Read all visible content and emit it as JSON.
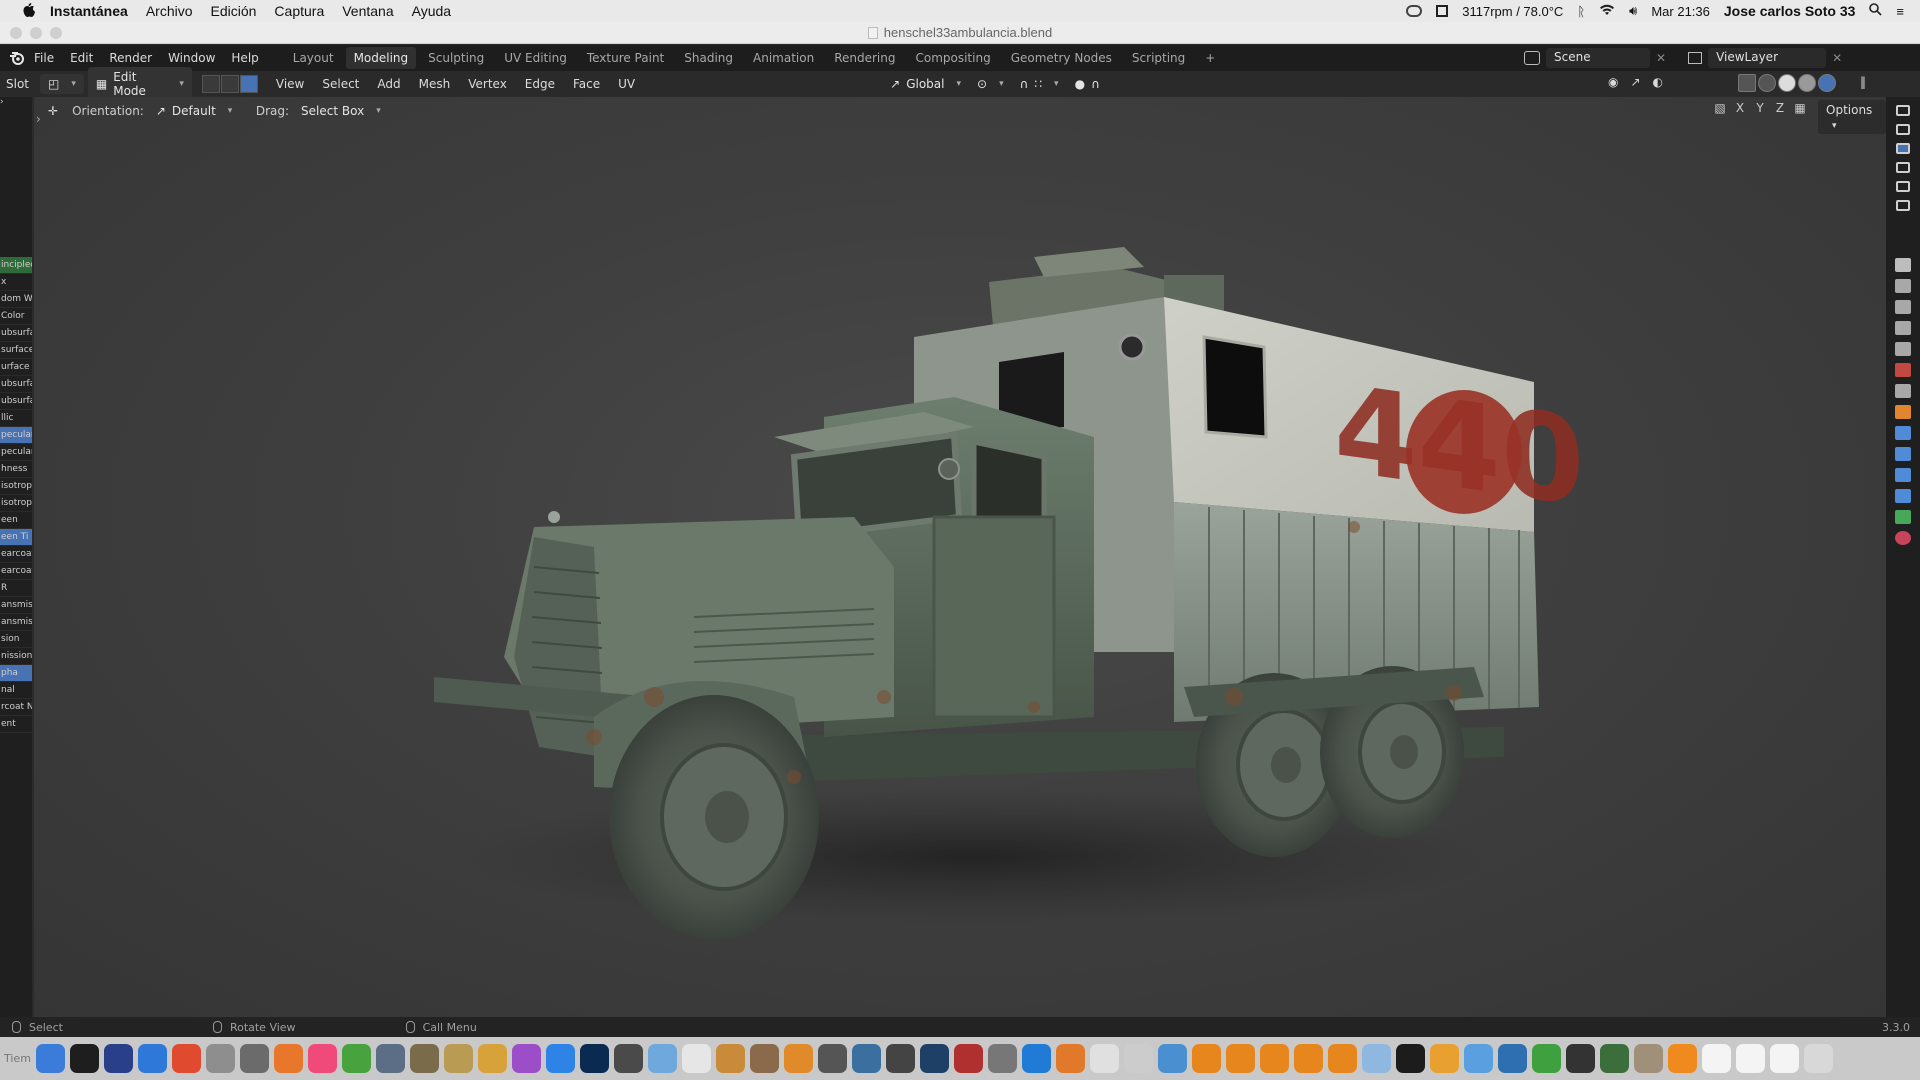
{
  "menubar": {
    "app_name": "Instantánea",
    "items": [
      "Archivo",
      "Edición",
      "Captura",
      "Ventana",
      "Ayuda"
    ],
    "status_text": "3117rpm / 78.0°C",
    "clock": "Mar 21:36",
    "user": "Jose carlos Soto 33"
  },
  "window": {
    "title": "henschel33ambulancia.blend"
  },
  "topbar": {
    "menus": [
      "File",
      "Edit",
      "Render",
      "Window",
      "Help"
    ],
    "workspaces": [
      "Layout",
      "Modeling",
      "Sculpting",
      "UV Editing",
      "Texture Paint",
      "Shading",
      "Animation",
      "Rendering",
      "Compositing",
      "Geometry Nodes",
      "Scripting"
    ],
    "active_workspace": "Modeling",
    "add_tab_label": "+",
    "scene_label": "Scene",
    "viewlayer_label": "ViewLayer"
  },
  "header": {
    "slot_label": "Slot",
    "mode": "Edit Mode",
    "menus": [
      "View",
      "Select",
      "Add",
      "Mesh",
      "Vertex",
      "Edge",
      "Face",
      "UV"
    ],
    "transform_orientation": "Global"
  },
  "tool_header": {
    "orientation_label": "Orientation:",
    "orientation_value": "Default",
    "drag_label": "Drag:",
    "drag_value": "Select Box",
    "axes": [
      "X",
      "Y",
      "Z"
    ],
    "options_label": "Options"
  },
  "left_panel": {
    "rows": [
      {
        "text": "incipled",
        "style": "green"
      },
      {
        "text": "x",
        "style": ""
      },
      {
        "text": "dom W",
        "style": ""
      },
      {
        "text": "Color",
        "style": ""
      },
      {
        "text": "ubsurfa",
        "style": ""
      },
      {
        "text": "surface",
        "style": ""
      },
      {
        "text": "urface C",
        "style": ""
      },
      {
        "text": "ubsurfa",
        "style": ""
      },
      {
        "text": "ubsurfa",
        "style": ""
      },
      {
        "text": "llic",
        "style": ""
      },
      {
        "text": "pecular",
        "style": "blue"
      },
      {
        "text": "pecular",
        "style": ""
      },
      {
        "text": "hness",
        "style": ""
      },
      {
        "text": "isotrop",
        "style": ""
      },
      {
        "text": "isotrop",
        "style": ""
      },
      {
        "text": "een",
        "style": ""
      },
      {
        "text": "een Ti",
        "style": "blue"
      },
      {
        "text": "earcoat",
        "style": ""
      },
      {
        "text": "earcoat",
        "style": ""
      },
      {
        "text": "R",
        "style": ""
      },
      {
        "text": "ansmis",
        "style": ""
      },
      {
        "text": "ansmis",
        "style": ""
      },
      {
        "text": "sion",
        "style": ""
      },
      {
        "text": "nission",
        "style": ""
      },
      {
        "text": "pha",
        "style": "blue"
      },
      {
        "text": "nal",
        "style": ""
      },
      {
        "text": "rcoat N",
        "style": ""
      },
      {
        "text": "ent",
        "style": ""
      }
    ]
  },
  "viewport": {
    "truck_marking": "440"
  },
  "statusbar": {
    "items": [
      "Select",
      "Rotate View",
      "Call Menu"
    ],
    "version": "3.3.0"
  },
  "dock": {
    "label": "Tiem",
    "icon_colors": [
      "#3b7bd9",
      "#1e1e1e",
      "#2a3f8a",
      "#2d78d8",
      "#e04a2f",
      "#8e8e8e",
      "#6b6b6b",
      "#e8762b",
      "#f04a7a",
      "#48a23e",
      "#5b6e86",
      "#7a6b4a",
      "#b99b54",
      "#d8a23a",
      "#9c4ec8",
      "#2e84e6",
      "#0a2a52",
      "#4a4a4a",
      "#6fa8dc",
      "#e6e6e6",
      "#c98a3a",
      "#8a6a4a",
      "#e08a2a",
      "#555555",
      "#3b6fa0",
      "#444444",
      "#1e3f66",
      "#b03030",
      "#777777",
      "#1f7bd6",
      "#e07a2a",
      "#e0e0e0",
      "#cccccc",
      "#4a8fd0",
      "#e8861e",
      "#e8861e",
      "#e8861e",
      "#e8861e",
      "#e8861e",
      "#8fb8e0",
      "#1c1c1c",
      "#e8a030",
      "#5aa0e0",
      "#2d6fb0",
      "#3fa03f",
      "#333333",
      "#3c6e3c",
      "#a0907a",
      "#f08a1e",
      "#f4f4f4",
      "#f4f4f4",
      "#f4f4f4",
      "#d8d8d8"
    ]
  },
  "colors": {
    "accent": "#4772b3",
    "blender_orange": "#e87d0d"
  }
}
